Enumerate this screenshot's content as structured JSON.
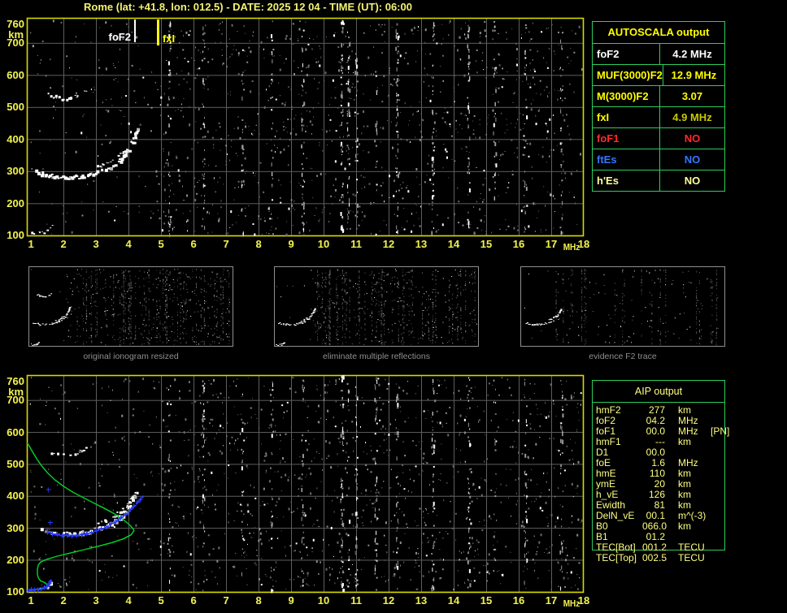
{
  "app": {
    "title": "Rome (lat: +41.8, lon: 012.5) - DATE: 2025 12 04 - TIME (UT): 06:00"
  },
  "colors": {
    "background": "#000000",
    "title_text": "#f2f272",
    "axis_text": "#f0f050",
    "plot_border": "#d8d800",
    "grid": "#5e5e5e",
    "table_border_green": "#2ecc5e",
    "echo_white": "#ffffff",
    "profile_green": "#00cc2a",
    "restored_blue": "#2a3bff",
    "caption_gray": "#8f8f8f",
    "aip_text": "#ffff80"
  },
  "autoscala": {
    "header": "AUTOSCALA output",
    "rows": [
      {
        "label": "foF2",
        "value": "4.2 MHz",
        "label_color": "#ffffff",
        "value_color": "#ffffff"
      },
      {
        "label": "MUF(3000)F2",
        "value": "12.9 MHz",
        "label_color": "#ffff00",
        "value_color": "#ffff00"
      },
      {
        "label": "M(3000)F2",
        "value": "3.07",
        "label_color": "#ffff00",
        "value_color": "#ffff00"
      },
      {
        "label": "fxI",
        "value": "4.9 MHz",
        "label_color": "#ffff00",
        "value_color": "#c9c900"
      },
      {
        "label": "foF1",
        "value": "NO",
        "label_color": "#ff2a2a",
        "value_color": "#ff2a2a"
      },
      {
        "label": "ftEs",
        "value": "NO",
        "label_color": "#3377ff",
        "value_color": "#3377ff"
      },
      {
        "label": "h'Es",
        "value": "NO",
        "label_color": "#ffff99",
        "value_color": "#ffff99"
      }
    ]
  },
  "aip": {
    "header": "AIP output",
    "rows": [
      {
        "label": "hmF2",
        "value": "277",
        "unit": "km",
        "extra": ""
      },
      {
        "label": "foF2",
        "value": "04.2",
        "unit": "MHz",
        "extra": ""
      },
      {
        "label": "foF1",
        "value": "00.0",
        "unit": "MHz",
        "extra": "[PN]"
      },
      {
        "label": "hmF1",
        "value": "---",
        "unit": "km",
        "extra": ""
      },
      {
        "label": "D1",
        "value": "00.0",
        "unit": "",
        "extra": ""
      },
      {
        "label": "foE",
        "value": "1.6",
        "unit": "MHz",
        "extra": ""
      },
      {
        "label": "hmE",
        "value": "110",
        "unit": "km",
        "extra": ""
      },
      {
        "label": "ymE",
        "value": "20",
        "unit": "km",
        "extra": ""
      },
      {
        "label": "h_vE",
        "value": "126",
        "unit": "km",
        "extra": ""
      },
      {
        "label": "Ewidth",
        "value": "81",
        "unit": "km",
        "extra": ""
      },
      {
        "label": "DelN_vE",
        "value": "00.1",
        "unit": "m^(-3)",
        "extra": ""
      },
      {
        "label": "B0",
        "value": "066.0",
        "unit": "km",
        "extra": ""
      },
      {
        "label": "B1",
        "value": "01.2",
        "unit": "",
        "extra": ""
      },
      {
        "label": "TEC[Bot]",
        "value": "001.2",
        "unit": "TECU",
        "extra": ""
      },
      {
        "label": "TEC[Top]",
        "value": "002.5",
        "unit": "TECU",
        "extra": ""
      }
    ]
  },
  "thumbnails": [
    {
      "caption": "original ionogram resized",
      "noise": 1150,
      "traces": [
        "f2_main",
        "f2_upper",
        "multiple",
        "e_layer"
      ],
      "seed": 21
    },
    {
      "caption": "eliminate multiple reflections",
      "noise": 1050,
      "traces": [
        "f2_main",
        "f2_upper",
        "e_layer"
      ],
      "seed": 22
    },
    {
      "caption": "evidence F2 trace",
      "noise": 520,
      "traces": [
        "f2_main",
        "f2_upper"
      ],
      "seed": 23
    }
  ],
  "chart_data": [
    {
      "type": "scatter",
      "name": "autoscaled-ionogram",
      "xlabel": "MHz",
      "ylabel": "km",
      "xlim": [
        0.875,
        18
      ],
      "ylim": [
        97,
        778
      ],
      "x_ticks": [
        1,
        2,
        3,
        4,
        5,
        6,
        7,
        8,
        9,
        10,
        11,
        12,
        13,
        14,
        15,
        16,
        17,
        18
      ],
      "y_ticks": [
        760,
        700,
        600,
        500,
        400,
        300,
        200,
        100
      ],
      "grid": true,
      "markers": [
        {
          "label": "foF2",
          "f_mhz": 4.2,
          "color": "#ffffff"
        },
        {
          "label": "fxI",
          "f_mhz": 4.9,
          "color": "#ffff00"
        }
      ],
      "echo_traces": [
        {
          "name": "f2_main",
          "points": [
            [
              1.15,
              299
            ],
            [
              1.35,
              294
            ],
            [
              1.55,
              290
            ],
            [
              1.75,
              286
            ],
            [
              1.95,
              284
            ],
            [
              2.15,
              283
            ],
            [
              2.35,
              284
            ],
            [
              2.55,
              286
            ],
            [
              2.75,
              290
            ],
            [
              2.95,
              295
            ],
            [
              3.15,
              302
            ],
            [
              3.35,
              311
            ],
            [
              3.55,
              323
            ],
            [
              3.72,
              337
            ],
            [
              3.87,
              353
            ],
            [
              4.0,
              371
            ],
            [
              4.1,
              391
            ],
            [
              4.18,
              412
            ],
            [
              4.24,
              430
            ]
          ]
        },
        {
          "name": "f2_upper",
          "points": [
            [
              3.05,
              318
            ],
            [
              3.3,
              327
            ],
            [
              3.55,
              340
            ],
            [
              3.75,
              355
            ],
            [
              3.92,
              372
            ],
            [
              4.06,
              391
            ],
            [
              4.18,
              410
            ],
            [
              4.28,
              430
            ]
          ]
        },
        {
          "name": "multiple",
          "points": [
            [
              1.5,
              541
            ],
            [
              1.7,
              534
            ],
            [
              1.95,
              530
            ],
            [
              2.2,
              530
            ],
            [
              2.4,
              534
            ],
            [
              2.55,
              542
            ],
            [
              2.67,
              553
            ]
          ]
        },
        {
          "name": "e_layer",
          "points": [
            [
              0.95,
              110
            ],
            [
              1.1,
              109
            ],
            [
              1.25,
              110
            ],
            [
              1.4,
              112
            ],
            [
              1.5,
              117
            ],
            [
              1.58,
              124
            ],
            [
              1.63,
              132
            ]
          ]
        }
      ],
      "noise_streaks_mhz": [
        5.25,
        6.3,
        7.5,
        8.4,
        9.35,
        10.55,
        10.75,
        11.0,
        11.6,
        12.25,
        13.35,
        14.45,
        15.25,
        16.2,
        17.3
      ],
      "noise": 1400,
      "seed": 11
    },
    {
      "type": "scatter",
      "name": "aip-ionogram-with-profile",
      "xlabel": "MHz",
      "ylabel": "km",
      "xlim": [
        0.875,
        18
      ],
      "ylim": [
        97,
        778
      ],
      "x_ticks": [
        1,
        2,
        3,
        4,
        5,
        6,
        7,
        8,
        9,
        10,
        11,
        12,
        13,
        14,
        15,
        16,
        17,
        18
      ],
      "y_ticks": [
        760,
        700,
        600,
        500,
        400,
        300,
        200,
        100
      ],
      "grid": true,
      "echo_traces": [
        {
          "name": "f2_main",
          "points": [
            [
              1.3,
              297
            ],
            [
              1.55,
              291
            ],
            [
              1.75,
              286
            ],
            [
              1.95,
              284
            ],
            [
              2.15,
              283
            ],
            [
              2.35,
              284
            ],
            [
              2.55,
              286
            ],
            [
              2.75,
              290
            ],
            [
              2.95,
              295
            ],
            [
              3.15,
              302
            ],
            [
              3.35,
              311
            ],
            [
              3.55,
              323
            ],
            [
              3.72,
              337
            ],
            [
              3.87,
              353
            ],
            [
              4.0,
              371
            ],
            [
              4.1,
              391
            ],
            [
              4.18,
              412
            ]
          ]
        },
        {
          "name": "f2_upper",
          "points": [
            [
              3.05,
              318
            ],
            [
              3.3,
              327
            ],
            [
              3.55,
              340
            ],
            [
              3.75,
              355
            ],
            [
              3.92,
              372
            ],
            [
              4.06,
              391
            ],
            [
              4.18,
              410
            ],
            [
              4.3,
              428
            ]
          ]
        },
        {
          "name": "multiple",
          "points": [
            [
              1.5,
              541
            ],
            [
              1.7,
              534
            ],
            [
              1.95,
              530
            ],
            [
              2.2,
              530
            ],
            [
              2.4,
              534
            ],
            [
              2.55,
              542
            ],
            [
              2.67,
              553
            ]
          ]
        },
        {
          "name": "e_layer",
          "points": [
            [
              0.95,
              110
            ],
            [
              1.1,
              109
            ],
            [
              1.25,
              110
            ],
            [
              1.4,
              112
            ],
            [
              1.5,
              117
            ],
            [
              1.58,
              124
            ],
            [
              1.63,
              132
            ]
          ]
        }
      ],
      "profile": {
        "name": "electron-density-profile",
        "points": [
          [
            0.88,
            566
          ],
          [
            0.95,
            556
          ],
          [
            1.05,
            538
          ],
          [
            1.18,
            516
          ],
          [
            1.33,
            494
          ],
          [
            1.52,
            471
          ],
          [
            1.75,
            449
          ],
          [
            2.0,
            430
          ],
          [
            2.3,
            411
          ],
          [
            2.62,
            394
          ],
          [
            2.95,
            377
          ],
          [
            3.28,
            360
          ],
          [
            3.58,
            343
          ],
          [
            3.85,
            325
          ],
          [
            4.05,
            308
          ],
          [
            4.15,
            296
          ],
          [
            4.17,
            291
          ],
          [
            4.08,
            278
          ],
          [
            3.85,
            266
          ],
          [
            3.5,
            254
          ],
          [
            3.1,
            243
          ],
          [
            2.65,
            232
          ],
          [
            2.2,
            221
          ],
          [
            1.8,
            211
          ],
          [
            1.5,
            202
          ],
          [
            1.3,
            193
          ],
          [
            1.23,
            184
          ],
          [
            1.2,
            170
          ],
          [
            1.2,
            155
          ],
          [
            1.23,
            143
          ],
          [
            1.3,
            134
          ],
          [
            1.42,
            129
          ],
          [
            1.5,
            122
          ],
          [
            1.48,
            114
          ],
          [
            1.35,
            110
          ],
          [
            1.15,
            108
          ],
          [
            0.95,
            107
          ]
        ]
      },
      "restored_trace": {
        "e_points": [
          [
            0.9,
            107
          ],
          [
            1.0,
            108
          ],
          [
            1.1,
            108
          ],
          [
            1.2,
            109
          ],
          [
            1.3,
            111
          ],
          [
            1.4,
            114
          ],
          [
            1.48,
            119
          ],
          [
            1.54,
            126
          ],
          [
            1.58,
            133
          ],
          [
            1.6,
            139
          ]
        ],
        "f_points": [
          [
            1.5,
            288
          ],
          [
            1.65,
            284
          ],
          [
            1.8,
            281
          ],
          [
            1.95,
            279
          ],
          [
            2.1,
            278
          ],
          [
            2.25,
            278
          ],
          [
            2.4,
            279
          ],
          [
            2.55,
            281
          ],
          [
            2.7,
            284
          ],
          [
            2.85,
            288
          ],
          [
            3.0,
            293
          ],
          [
            3.15,
            299
          ],
          [
            3.3,
            306
          ],
          [
            3.45,
            314
          ],
          [
            3.6,
            323
          ],
          [
            3.75,
            333
          ],
          [
            3.9,
            345
          ],
          [
            4.03,
            357
          ],
          [
            4.15,
            370
          ],
          [
            4.26,
            382
          ],
          [
            4.35,
            392
          ],
          [
            4.42,
            399
          ]
        ],
        "isolated_points": [
          [
            1.52,
            421
          ],
          [
            1.58,
            318
          ],
          [
            1.5,
            296
          ]
        ]
      },
      "noise_streaks_mhz": [
        5.25,
        6.3,
        7.5,
        8.4,
        9.35,
        10.55,
        10.75,
        11.0,
        11.6,
        12.25,
        13.35,
        14.45,
        15.25,
        16.2,
        17.3
      ],
      "noise": 1400,
      "seed": 77
    }
  ]
}
